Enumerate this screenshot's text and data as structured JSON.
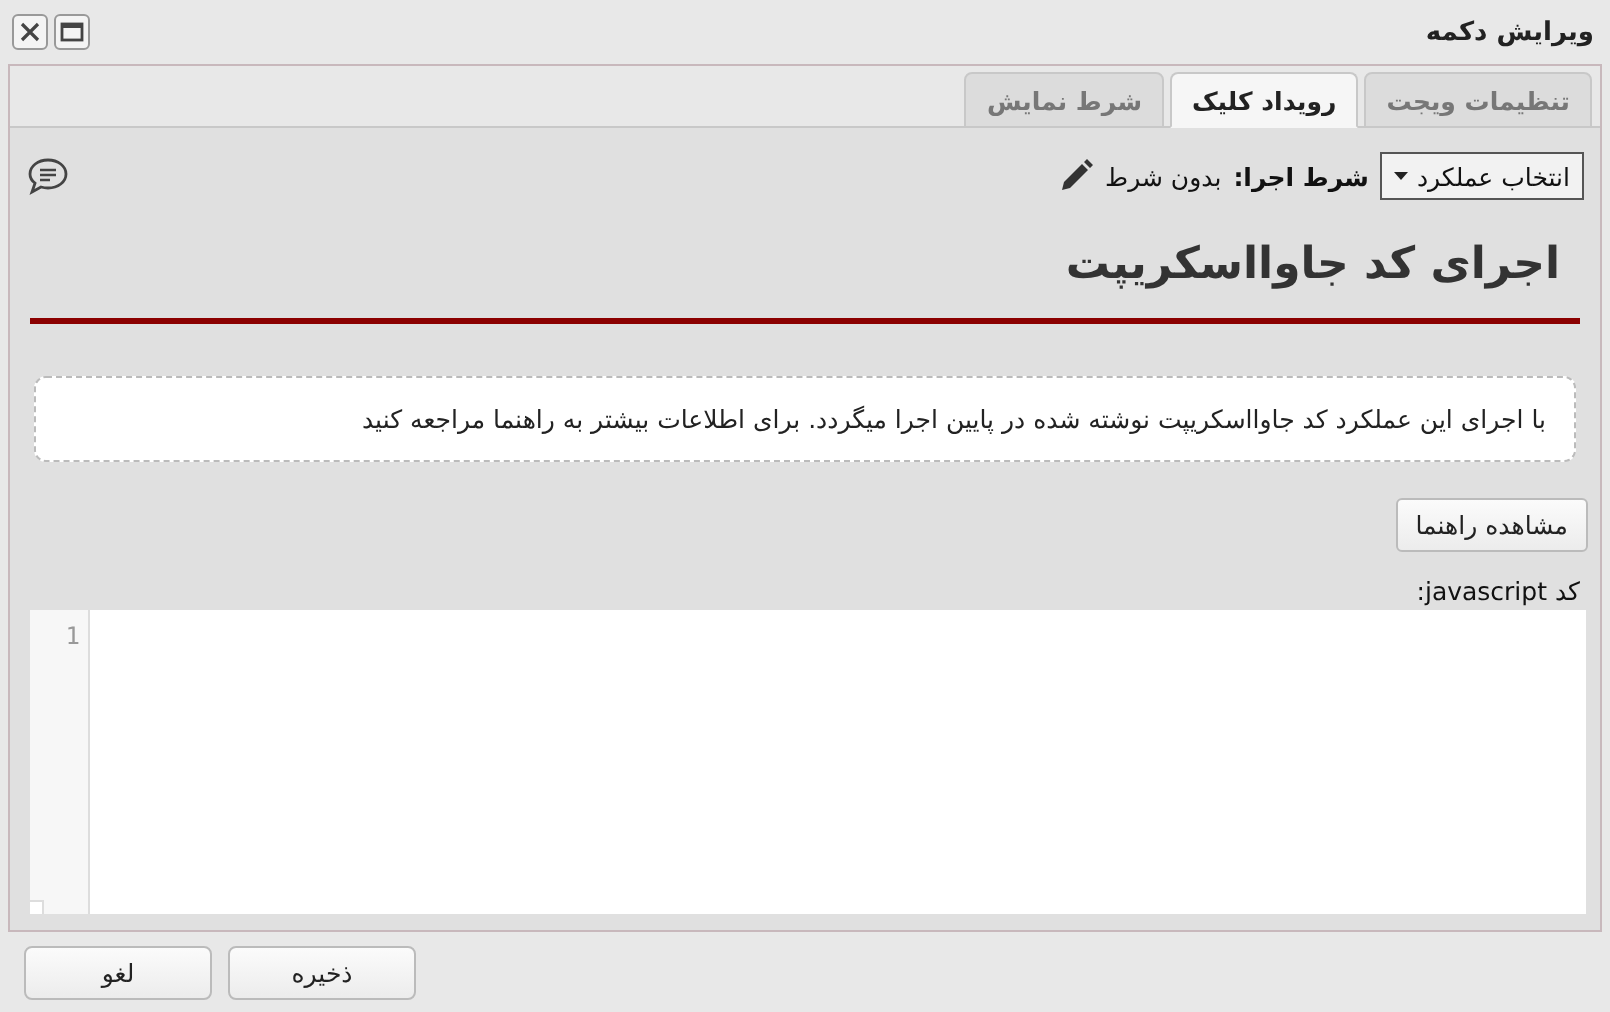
{
  "window": {
    "title": "ویرایش دکمه"
  },
  "tabs": [
    {
      "label": "تنظیمات ویجت",
      "selected": false
    },
    {
      "label": "رویداد کلیک",
      "selected": true
    },
    {
      "label": "شرط نمایش",
      "selected": false
    }
  ],
  "toolbar": {
    "action_select": "انتخاب عملکرد",
    "condition_label": "شرط اجرا:",
    "condition_value": "بدون شرط"
  },
  "heading": "اجرای کد جاوااسکریپت",
  "info": "با اجرای این عملکرد کد جاوااسکریپت نوشته شده در پایین اجرا میگردد. برای اطلاعات بیشتر به راهنما مراجعه کنید",
  "help_button": "مشاهده راهنما",
  "code_label": "کد javascript:",
  "editor": {
    "line_numbers": [
      "1"
    ]
  },
  "buttons": [
    {
      "label": "ذخیره"
    },
    {
      "label": "لغو"
    }
  ]
}
